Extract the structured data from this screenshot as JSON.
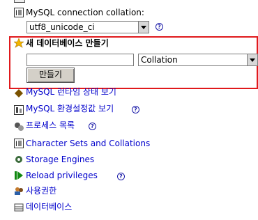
{
  "collation": {
    "label": "MySQL connection collation:",
    "selected": "utf8_unicode_ci",
    "help_glyph": "?"
  },
  "create_db": {
    "title": "새 데이터베이스 만들기",
    "name_value": "",
    "collation_selected": "Collation",
    "button_label": "만들기",
    "highlight_color": "#e0191c"
  },
  "menu": {
    "items": [
      {
        "label": "MySQL 런타임 상태 보기",
        "icon": "status-icon",
        "help": false
      },
      {
        "label": "MySQL 환경설정값 보기",
        "icon": "variables-icon",
        "help": true
      },
      {
        "label": "프로세스 목록",
        "icon": "processes-icon",
        "help": true
      },
      {
        "label": "Character Sets and Collations",
        "icon": "charset-icon",
        "help": false
      },
      {
        "label": "Storage Engines",
        "icon": "engines-icon",
        "help": false
      },
      {
        "label": "Reload privileges",
        "icon": "reload-icon",
        "help": true
      },
      {
        "label": "사용권한",
        "icon": "privileges-icon",
        "help": false
      },
      {
        "label": "데이터베이스",
        "icon": "databases-icon",
        "help": false
      }
    ]
  },
  "colors": {
    "link": "#0000cc"
  }
}
